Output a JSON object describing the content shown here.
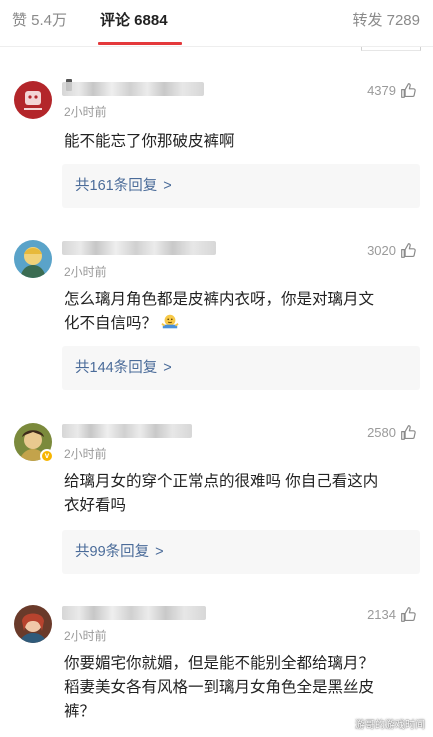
{
  "tabs": {
    "likes": "赞 5.4万",
    "comments": "评论 6884",
    "reposts": "转发 7289"
  },
  "comments": [
    {
      "time": "2小时前",
      "likes": "4379",
      "text_lines": [
        "能不能忘了你那破皮裤啊"
      ],
      "replies": "共161条回复",
      "avatar_color": "#c0392b"
    },
    {
      "time": "2小时前",
      "likes": "3020",
      "text_lines": [
        "怎么璃月角色都是皮裤内衣呀，你是对璃月文",
        "化不自信吗？"
      ],
      "replies": "共144条回复",
      "avatar_color": "#e8c75a"
    },
    {
      "time": "2小时前",
      "likes": "2580",
      "text_lines": [
        "给璃月女的穿个正常点的很难吗 你自己看这内",
        "衣好看吗"
      ],
      "replies": "共99条回复",
      "avatar_color": "#6b7a3a"
    },
    {
      "time": "2小时前",
      "likes": "2134",
      "text_lines": [
        "你要媚宅你就媚，但是能不能别全都给璃月？",
        "稻妻美女各有风格一到璃月女角色全是黑丝皮",
        "裤？"
      ],
      "avatar_color": "#8a4b3a"
    }
  ],
  "reply_chevron": ">",
  "watermark": "游哥的游戏时间",
  "colors": {
    "accent_underline": "#e4393c",
    "reply_link": "#4a6b99",
    "muted": "#9a9a9a"
  }
}
